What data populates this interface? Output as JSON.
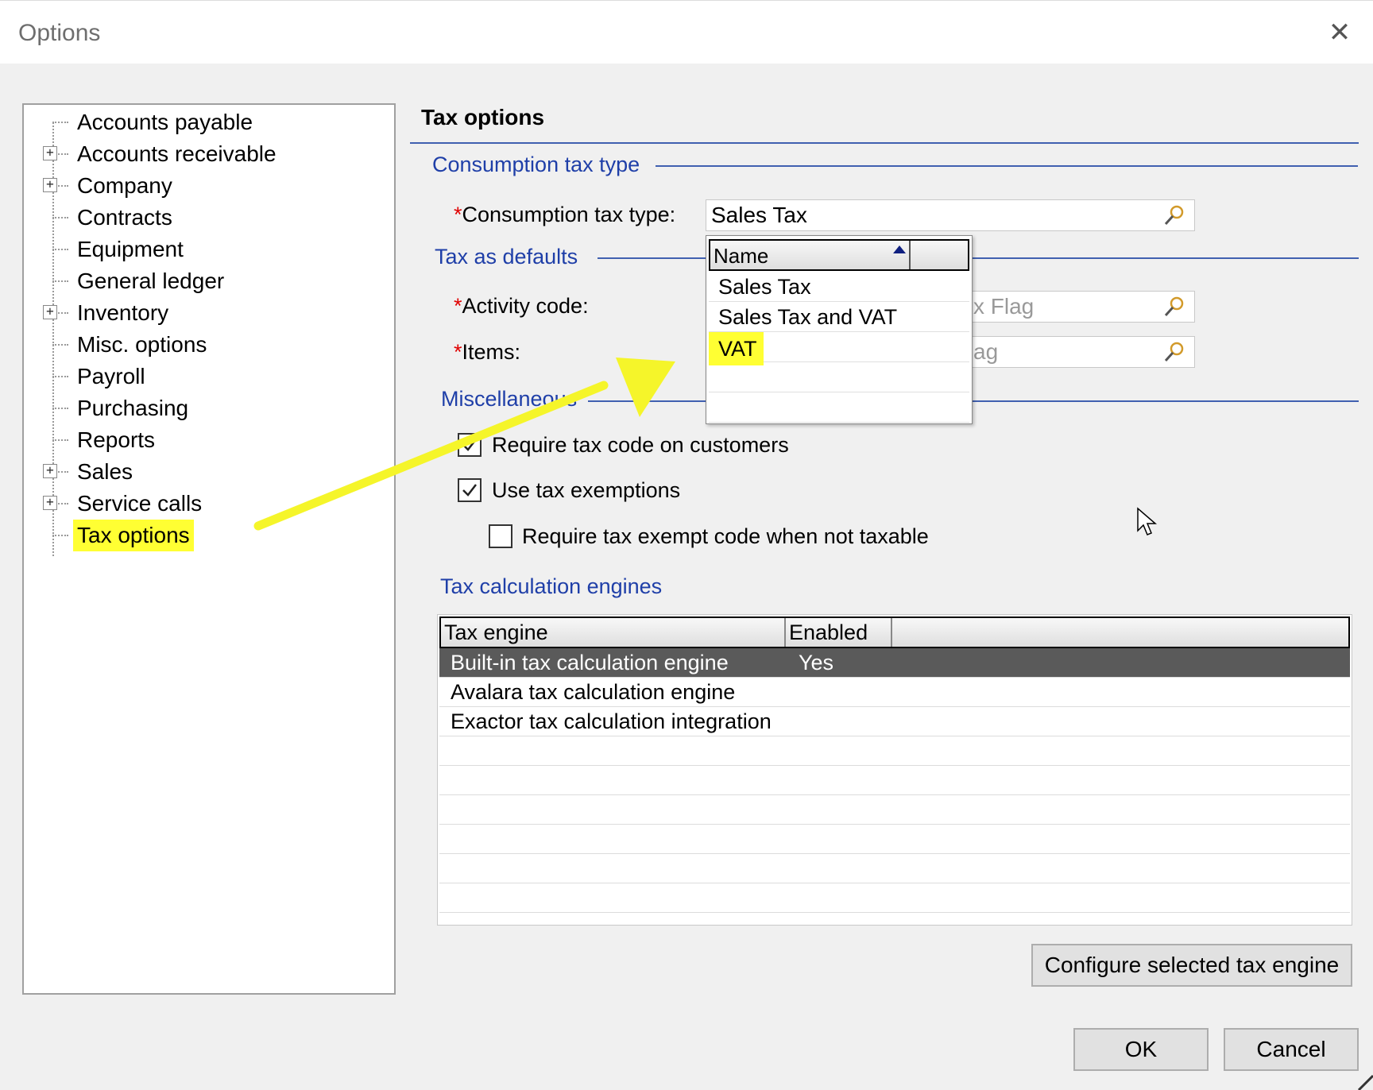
{
  "window": {
    "title": "Options",
    "close_glyph": "✕"
  },
  "tree": {
    "items": [
      {
        "label": "Accounts payable",
        "expandable": false
      },
      {
        "label": "Accounts receivable",
        "expandable": true
      },
      {
        "label": "Company",
        "expandable": true
      },
      {
        "label": "Contracts",
        "expandable": false
      },
      {
        "label": "Equipment",
        "expandable": false
      },
      {
        "label": "General ledger",
        "expandable": false
      },
      {
        "label": "Inventory",
        "expandable": true
      },
      {
        "label": "Misc. options",
        "expandable": false
      },
      {
        "label": "Payroll",
        "expandable": false
      },
      {
        "label": "Purchasing",
        "expandable": false
      },
      {
        "label": "Reports",
        "expandable": false
      },
      {
        "label": "Sales",
        "expandable": true
      },
      {
        "label": "Service calls",
        "expandable": true
      },
      {
        "label": "Tax options",
        "expandable": false,
        "selected": true
      }
    ],
    "expander_glyph": "+"
  },
  "panel": {
    "title": "Tax options",
    "groups": {
      "consumption": "Consumption tax type",
      "defaults": "Tax as defaults",
      "misc": "Miscellaneous",
      "engines": "Tax calculation engines"
    },
    "fields": {
      "required_marker": "*",
      "consumption_label": "Consumption tax type:",
      "consumption_value": "Sales Tax",
      "activity_label": "Activity code:",
      "activity_value_visible": "x Flag",
      "items_label": "Items:",
      "items_value_visible": "ag"
    },
    "dropdown": {
      "header": "Name",
      "options": [
        "Sales Tax",
        "Sales Tax and VAT",
        "VAT",
        "",
        ""
      ],
      "highlighted": "VAT"
    },
    "checkboxes": [
      {
        "label": "Require tax code on customers",
        "checked": true
      },
      {
        "label": "Use tax exemptions",
        "checked": true
      },
      {
        "label": "Require tax exempt code when not taxable",
        "checked": false
      }
    ],
    "grid": {
      "columns": [
        "Tax engine",
        "Enabled"
      ],
      "rows": [
        {
          "engine": "Built-in tax calculation engine",
          "enabled": "Yes",
          "selected": true
        },
        {
          "engine": "Avalara tax calculation engine",
          "enabled": ""
        },
        {
          "engine": "Exactor tax calculation integration",
          "enabled": ""
        }
      ]
    },
    "configure_button": "Configure selected tax engine"
  },
  "footer": {
    "ok": "OK",
    "cancel": "Cancel"
  },
  "colors": {
    "highlight": "#ffff33",
    "group_text": "#1f3fa8",
    "divider": "#4060b0",
    "annotation_arrow": "#f5f52a"
  },
  "icons": [
    "close-icon",
    "expand-plus-icon",
    "magnifier-icon",
    "sort-ascending-icon",
    "checkmark-icon",
    "mouse-cursor-icon",
    "resize-grip-icon"
  ]
}
